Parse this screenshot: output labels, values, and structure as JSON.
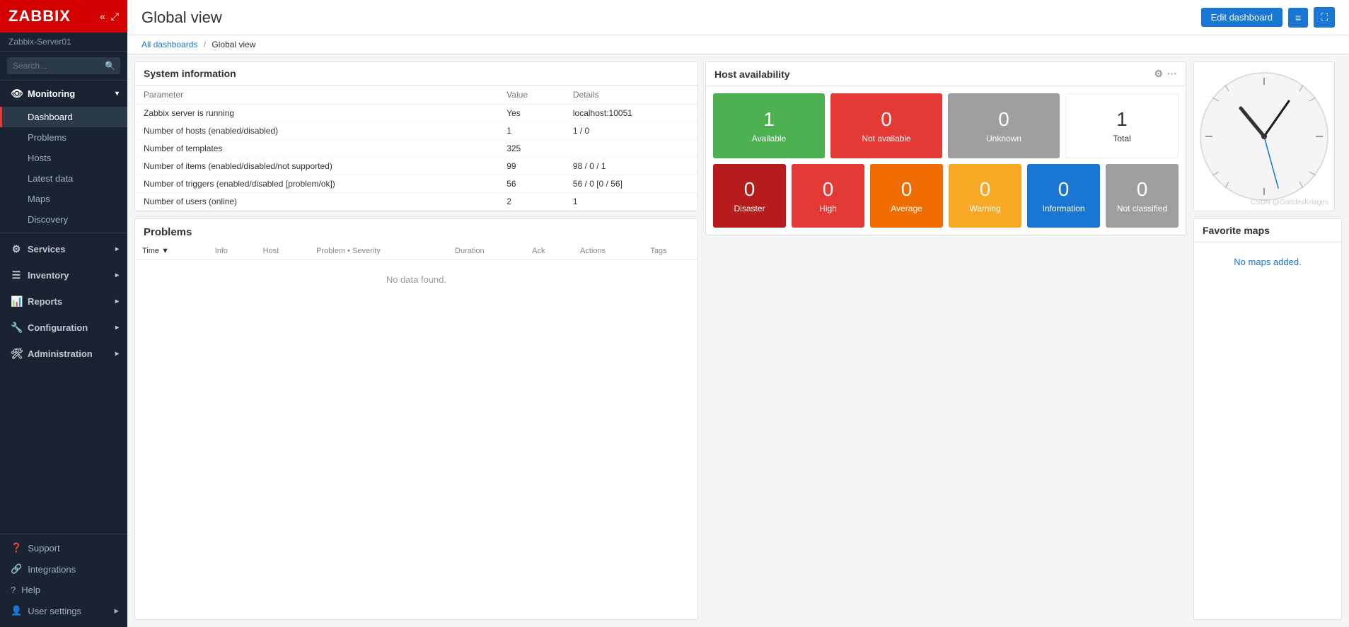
{
  "app": {
    "logo": "ZABBIX",
    "server": "Zabbix-Server01"
  },
  "sidebar": {
    "search_placeholder": "Search...",
    "nav": [
      {
        "id": "monitoring",
        "label": "Monitoring",
        "icon": "👁",
        "expanded": true,
        "active": true,
        "children": [
          {
            "id": "dashboard",
            "label": "Dashboard",
            "active": true
          },
          {
            "id": "problems",
            "label": "Problems",
            "active": false
          },
          {
            "id": "hosts",
            "label": "Hosts",
            "active": false
          },
          {
            "id": "latest-data",
            "label": "Latest data",
            "active": false
          },
          {
            "id": "maps",
            "label": "Maps",
            "active": false
          },
          {
            "id": "discovery",
            "label": "Discovery",
            "active": false
          }
        ]
      },
      {
        "id": "services",
        "label": "Services",
        "icon": "⚙",
        "expanded": false,
        "children": []
      },
      {
        "id": "inventory",
        "label": "Inventory",
        "icon": "☰",
        "expanded": false,
        "children": []
      },
      {
        "id": "reports",
        "label": "Reports",
        "icon": "📊",
        "expanded": false,
        "children": []
      },
      {
        "id": "configuration",
        "label": "Configuration",
        "icon": "🔧",
        "expanded": false,
        "children": []
      },
      {
        "id": "administration",
        "label": "Administration",
        "icon": "🛠",
        "expanded": false,
        "children": []
      }
    ],
    "bottom_links": [
      {
        "id": "support",
        "label": "Support",
        "icon": "❓"
      },
      {
        "id": "integrations",
        "label": "Integrations",
        "icon": "🔗"
      },
      {
        "id": "help",
        "label": "Help",
        "icon": "?"
      },
      {
        "id": "user-settings",
        "label": "User settings",
        "icon": "👤"
      }
    ]
  },
  "topbar": {
    "page_title": "Global view",
    "edit_dashboard_label": "Edit dashboard",
    "list_icon": "≡",
    "fullscreen_icon": "⛶"
  },
  "breadcrumb": {
    "all_dashboards": "All dashboards",
    "separator": "/",
    "current": "Global view"
  },
  "system_info": {
    "panel_title": "System information",
    "columns": [
      "Parameter",
      "Value",
      "Details"
    ],
    "rows": [
      {
        "param": "Zabbix server is running",
        "value": "Yes",
        "details": "localhost:10051",
        "value_class": "val-yes",
        "details_class": "val-link"
      },
      {
        "param": "Number of hosts (enabled/disabled)",
        "value": "1",
        "details": "1 / 0",
        "value_class": "val-link",
        "details_class": "val-green"
      },
      {
        "param": "Number of templates",
        "value": "325",
        "details": "",
        "value_class": "",
        "details_class": ""
      },
      {
        "param": "Number of items (enabled/disabled/not supported)",
        "value": "99",
        "details": "98 / 0 / 1",
        "value_class": "",
        "details_class": "val-green"
      },
      {
        "param": "Number of triggers (enabled/disabled [problem/ok])",
        "value": "56",
        "details": "56 / 0 [0 / 56]",
        "value_class": "",
        "details_class": "val-link"
      },
      {
        "param": "Number of users (online)",
        "value": "2",
        "details": "1",
        "value_class": "",
        "details_class": ""
      }
    ]
  },
  "host_availability": {
    "panel_title": "Host availability",
    "top_row": [
      {
        "num": "1",
        "label": "Available",
        "color_class": "avail-green"
      },
      {
        "num": "0",
        "label": "Not available",
        "color_class": "avail-red"
      },
      {
        "num": "0",
        "label": "Unknown",
        "color_class": "avail-gray"
      },
      {
        "num": "1",
        "label": "Total",
        "color_class": "avail-total"
      }
    ],
    "bottom_row": [
      {
        "num": "0",
        "label": "Disaster",
        "color_class": "sev-disaster"
      },
      {
        "num": "0",
        "label": "High",
        "color_class": "sev-high"
      },
      {
        "num": "0",
        "label": "Average",
        "color_class": "sev-average"
      },
      {
        "num": "0",
        "label": "Warning",
        "color_class": "sev-warning"
      },
      {
        "num": "0",
        "label": "Information",
        "color_class": "sev-info"
      },
      {
        "num": "0",
        "label": "Not classified",
        "color_class": "sev-nc"
      }
    ]
  },
  "problems": {
    "title": "Problems",
    "columns": [
      "Time ▼",
      "Info",
      "Host",
      "Problem • Severity",
      "Duration",
      "Ack",
      "Actions",
      "Tags"
    ],
    "no_data": "No data found."
  },
  "favorite_maps": {
    "panel_title": "Favorite maps",
    "no_maps": "No maps added."
  },
  "watermark": "CSDN @GottdesKrieges"
}
